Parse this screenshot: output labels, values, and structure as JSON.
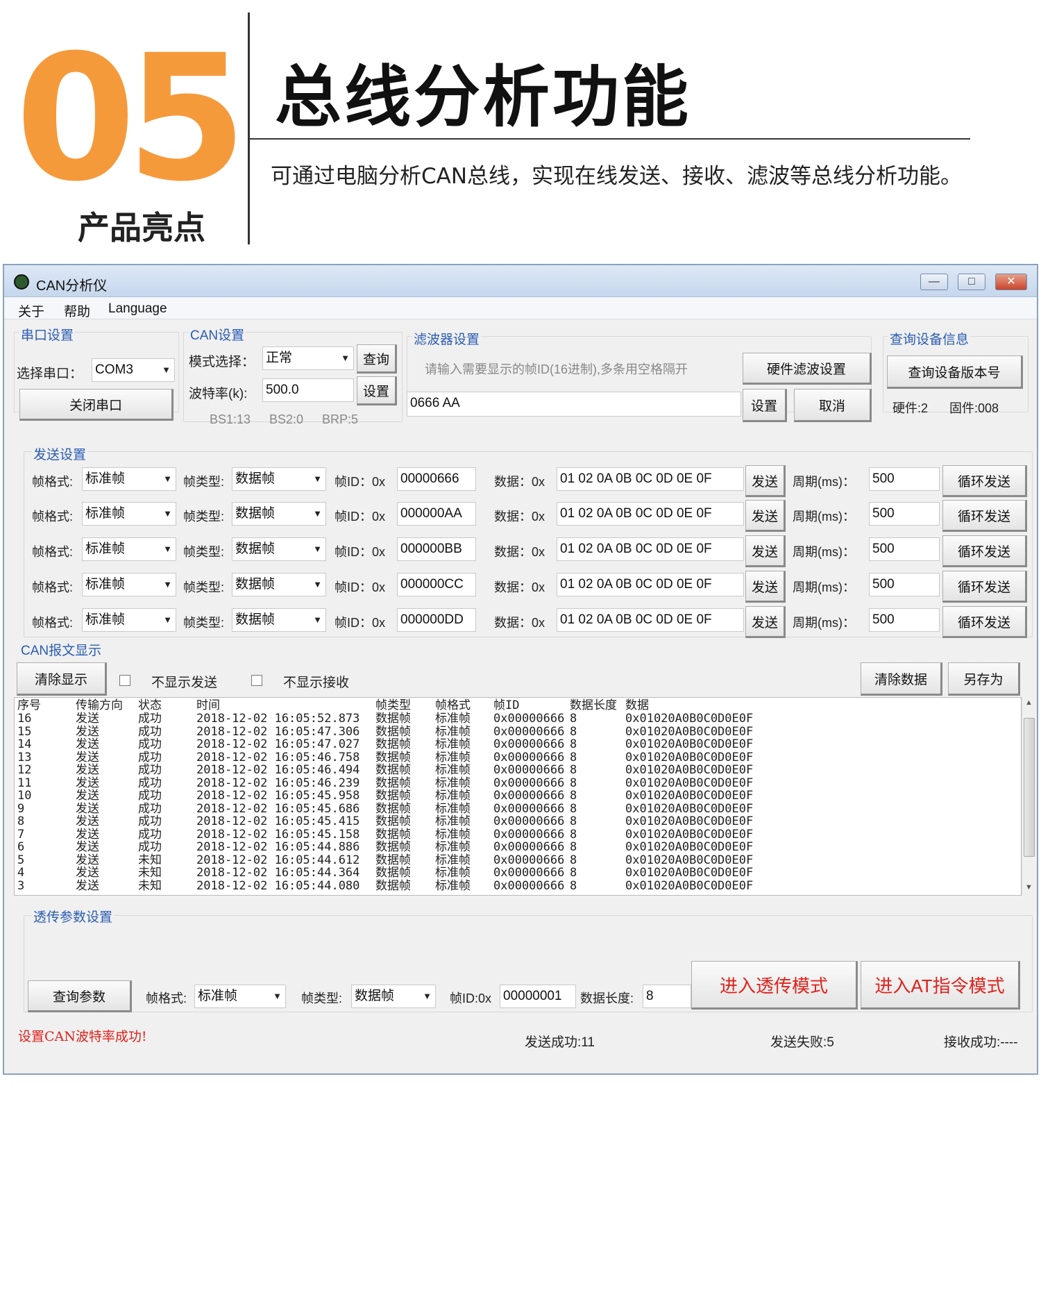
{
  "hero": {
    "number": "05",
    "highlight": "产品亮点",
    "title": "总线分析功能",
    "description": "可通过电脑分析CAN总线，实现在线发送、接收、滤波等总线分析功能。"
  },
  "window": {
    "title": "CAN分析仪",
    "min": "—",
    "max": "□",
    "close": "✕",
    "menu": [
      "关于",
      "帮助",
      "Language"
    ]
  },
  "serial": {
    "label": "串口设置",
    "port_label": "选择串口：",
    "port_value": "COM3",
    "close_button": "关闭串口"
  },
  "can": {
    "label": "CAN设置",
    "mode_label": "模式选择：",
    "mode_value": "正常",
    "query_button": "查询",
    "baud_label": "波特率(k):",
    "baud_value": "500.0",
    "set_button": "设置",
    "bs1": "BS1:13",
    "bs2": "BS2:0",
    "brp": "BRP:5"
  },
  "filter": {
    "label": "滤波器设置",
    "hint": "请输入需要显示的帧ID(16进制),多条用空格隔开",
    "hw_button": "硬件滤波设置",
    "value": "0666 AA",
    "set_button": "设置",
    "cancel_button": "取消"
  },
  "device": {
    "label": "查询设备信息",
    "query_button": "查询设备版本号",
    "hardware": "硬件:2",
    "firmware": "固件:008"
  },
  "send": {
    "label": "发送设置",
    "format_label": "帧格式:",
    "type_label": "帧类型:",
    "id_label": "帧ID：0x",
    "data_label": "数据：0x",
    "send_button": "发送",
    "period_label": "周期(ms)：",
    "loop_button": "循环发送",
    "rows": [
      {
        "format": "标准帧",
        "type": "数据帧",
        "id": "00000666",
        "data": "01 02 0A 0B 0C 0D 0E 0F",
        "period": "500"
      },
      {
        "format": "标准帧",
        "type": "数据帧",
        "id": "000000AA",
        "data": "01 02 0A 0B 0C 0D 0E 0F",
        "period": "500"
      },
      {
        "format": "标准帧",
        "type": "数据帧",
        "id": "000000BB",
        "data": "01 02 0A 0B 0C 0D 0E 0F",
        "period": "500"
      },
      {
        "format": "标准帧",
        "type": "数据帧",
        "id": "000000CC",
        "data": "01 02 0A 0B 0C 0D 0E 0F",
        "period": "500"
      },
      {
        "format": "标准帧",
        "type": "数据帧",
        "id": "000000DD",
        "data": "01 02 0A 0B 0C 0D 0E 0F",
        "period": "500"
      }
    ]
  },
  "display": {
    "label": "CAN报文显示",
    "clear_display": "清除显示",
    "hide_send": "不显示发送",
    "hide_recv": "不显示接收",
    "clear_data": "清除数据",
    "save_as": "另存为"
  },
  "log": {
    "headers": [
      "序号",
      "传输方向",
      "状态",
      "时间",
      "帧类型",
      "帧格式",
      "帧ID",
      "数据长度",
      "数据"
    ],
    "rows": [
      [
        "16",
        "发送",
        "成功",
        "2018-12-02 16:05:52.873",
        "数据帧",
        "标准帧",
        "0x00000666",
        "8",
        "0x01020A0B0C0D0E0F"
      ],
      [
        "15",
        "发送",
        "成功",
        "2018-12-02 16:05:47.306",
        "数据帧",
        "标准帧",
        "0x00000666",
        "8",
        "0x01020A0B0C0D0E0F"
      ],
      [
        "14",
        "发送",
        "成功",
        "2018-12-02 16:05:47.027",
        "数据帧",
        "标准帧",
        "0x00000666",
        "8",
        "0x01020A0B0C0D0E0F"
      ],
      [
        "13",
        "发送",
        "成功",
        "2018-12-02 16:05:46.758",
        "数据帧",
        "标准帧",
        "0x00000666",
        "8",
        "0x01020A0B0C0D0E0F"
      ],
      [
        "12",
        "发送",
        "成功",
        "2018-12-02 16:05:46.494",
        "数据帧",
        "标准帧",
        "0x00000666",
        "8",
        "0x01020A0B0C0D0E0F"
      ],
      [
        "11",
        "发送",
        "成功",
        "2018-12-02 16:05:46.239",
        "数据帧",
        "标准帧",
        "0x00000666",
        "8",
        "0x01020A0B0C0D0E0F"
      ],
      [
        "10",
        "发送",
        "成功",
        "2018-12-02 16:05:45.958",
        "数据帧",
        "标准帧",
        "0x00000666",
        "8",
        "0x01020A0B0C0D0E0F"
      ],
      [
        "9",
        "发送",
        "成功",
        "2018-12-02 16:05:45.686",
        "数据帧",
        "标准帧",
        "0x00000666",
        "8",
        "0x01020A0B0C0D0E0F"
      ],
      [
        "8",
        "发送",
        "成功",
        "2018-12-02 16:05:45.415",
        "数据帧",
        "标准帧",
        "0x00000666",
        "8",
        "0x01020A0B0C0D0E0F"
      ],
      [
        "7",
        "发送",
        "成功",
        "2018-12-02 16:05:45.158",
        "数据帧",
        "标准帧",
        "0x00000666",
        "8",
        "0x01020A0B0C0D0E0F"
      ],
      [
        "6",
        "发送",
        "成功",
        "2018-12-02 16:05:44.886",
        "数据帧",
        "标准帧",
        "0x00000666",
        "8",
        "0x01020A0B0C0D0E0F"
      ],
      [
        "5",
        "发送",
        "未知",
        "2018-12-02 16:05:44.612",
        "数据帧",
        "标准帧",
        "0x00000666",
        "8",
        "0x01020A0B0C0D0E0F"
      ],
      [
        "4",
        "发送",
        "未知",
        "2018-12-02 16:05:44.364",
        "数据帧",
        "标准帧",
        "0x00000666",
        "8",
        "0x01020A0B0C0D0E0F"
      ],
      [
        "3",
        "发送",
        "未知",
        "2018-12-02 16:05:44.080",
        "数据帧",
        "标准帧",
        "0x00000666",
        "8",
        "0x01020A0B0C0D0E0F"
      ]
    ]
  },
  "passthrough": {
    "label": "透传参数设置",
    "query_button": "查询参数",
    "format_label": "帧格式:",
    "format_value": "标准帧",
    "type_label": "帧类型:",
    "type_value": "数据帧",
    "id_label": "帧ID:0x",
    "id_value": "00000001",
    "len_label": "数据长度:",
    "len_value": "8",
    "enter_pass": "进入透传模式",
    "enter_at": "进入AT指令模式"
  },
  "statusbar": {
    "message": "设置CAN波特率成功!",
    "sent_ok": "发送成功:11",
    "sent_fail": "发送失败:5",
    "recv_ok": "接收成功:----"
  },
  "colors": {
    "accent_orange": "#f59a3b",
    "group_blue": "#2a5cb3",
    "alert_red": "#e0221b"
  }
}
